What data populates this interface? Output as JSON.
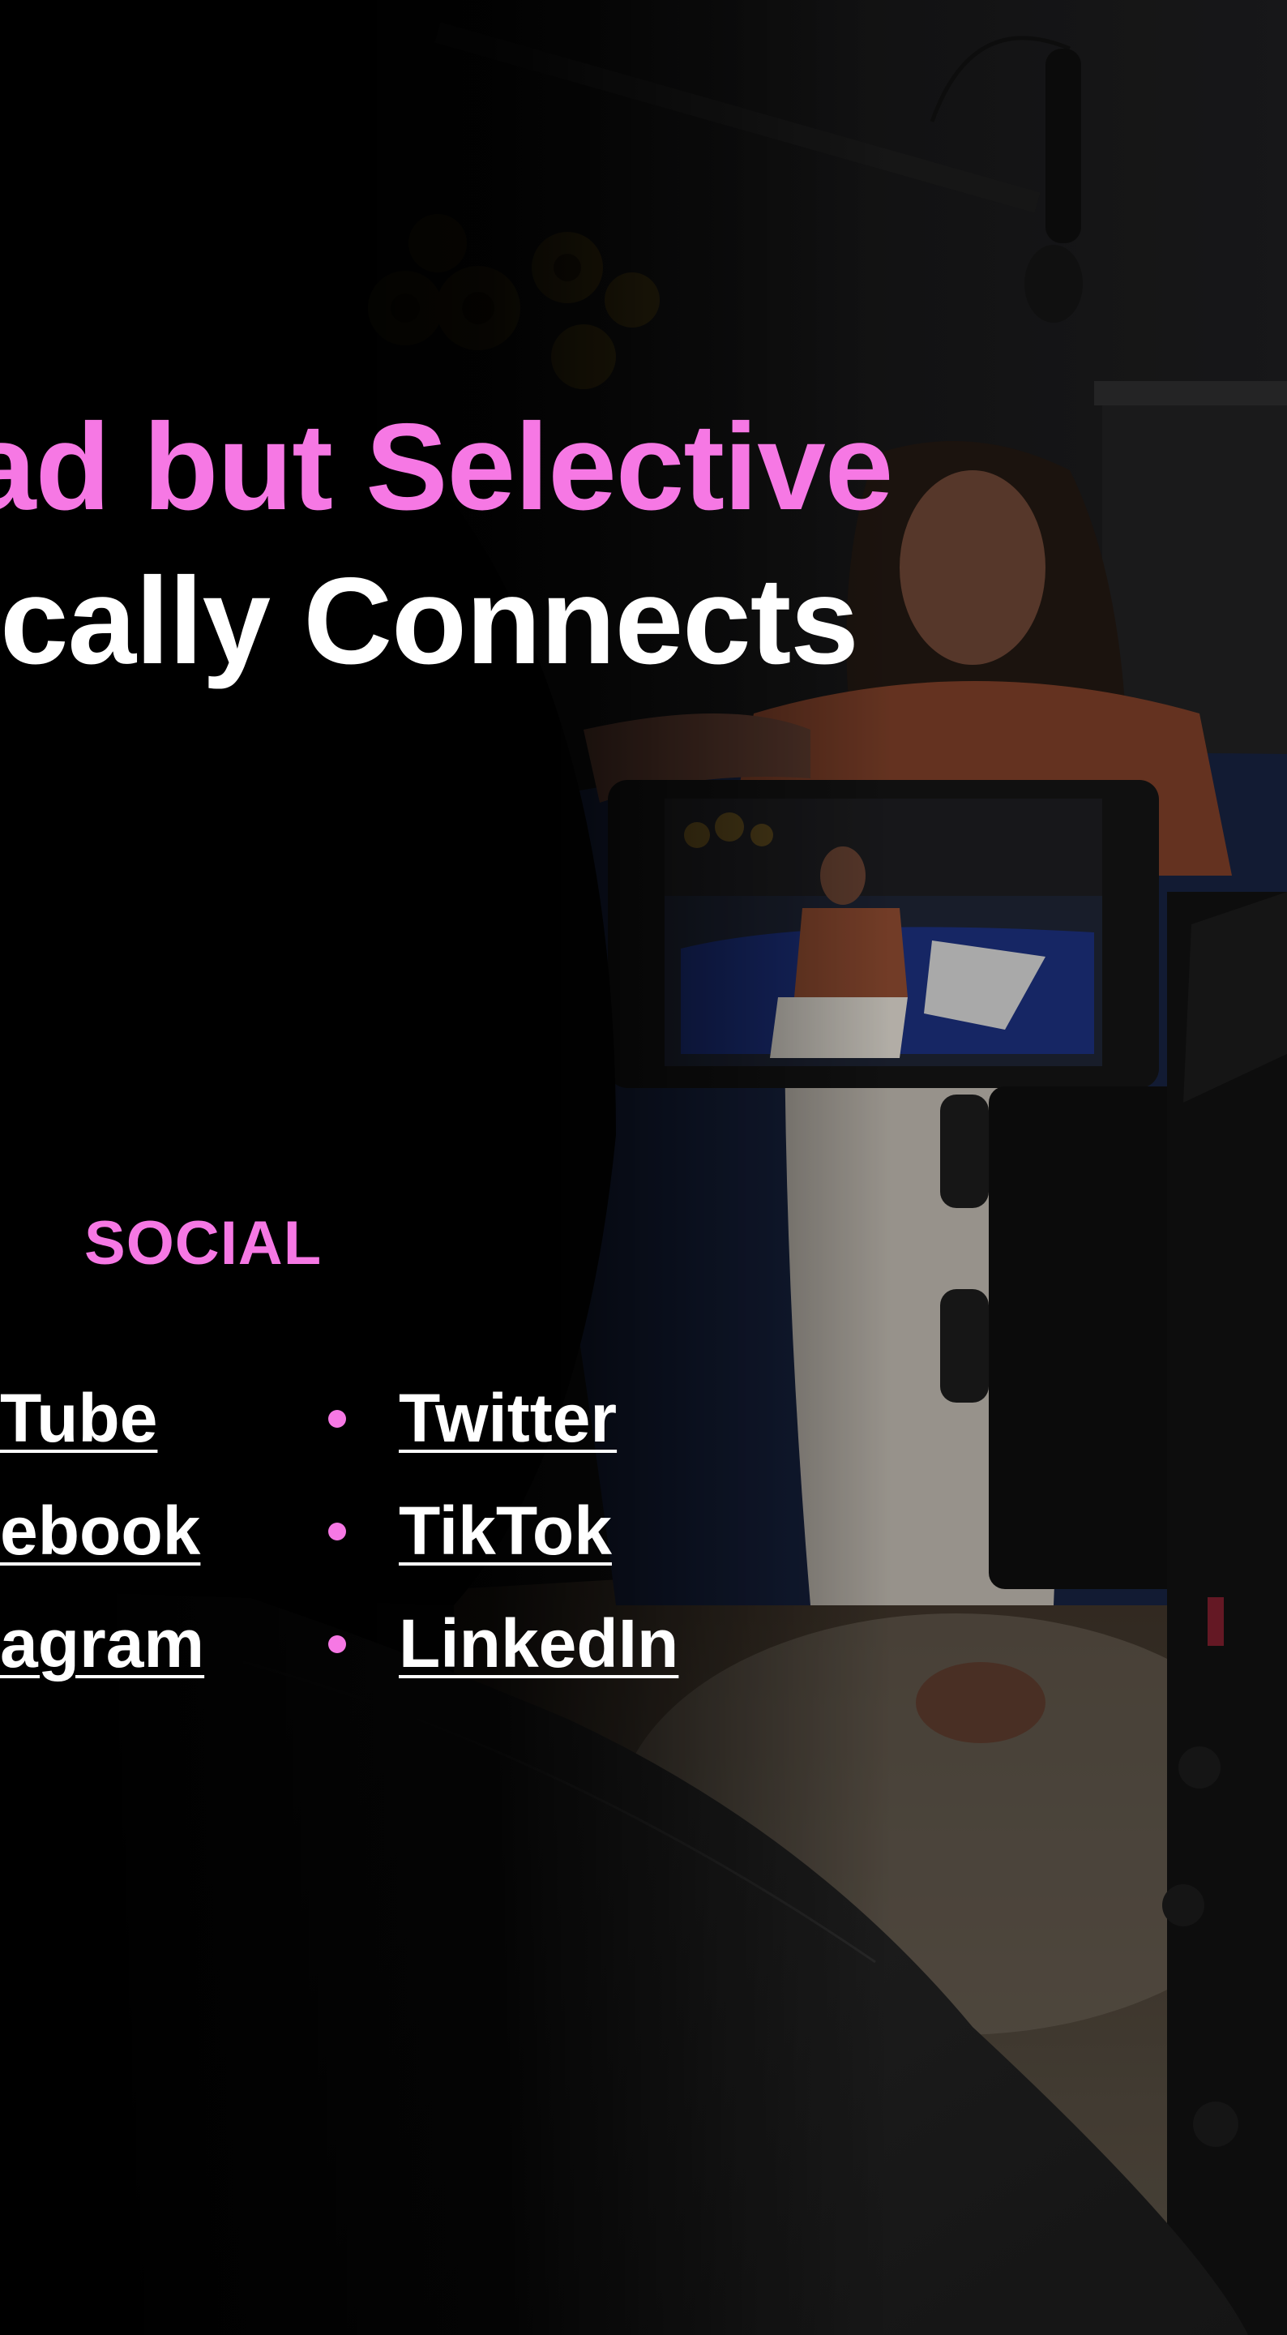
{
  "hero": {
    "line1": "ad but Selective",
    "line2": "cally Connects",
    "line1_color": "#f678e4",
    "line2_color": "#ffffff"
  },
  "social": {
    "heading": "SOCIAL",
    "accent_color": "#f678e4",
    "left_column": [
      "Tube",
      "ebook",
      "agram"
    ],
    "right_column": [
      "Twitter",
      "TikTok",
      "LinkedIn"
    ]
  }
}
